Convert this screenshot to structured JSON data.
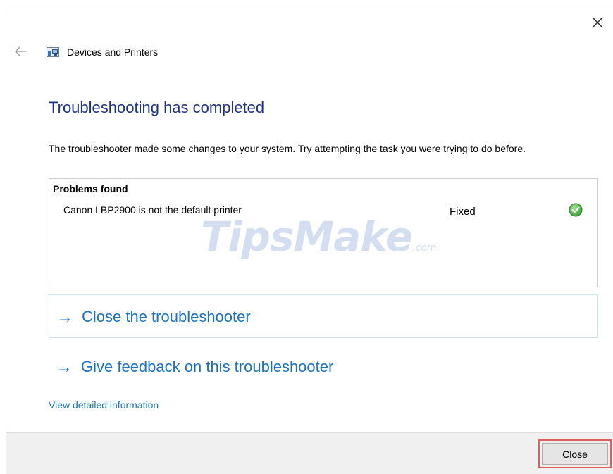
{
  "window": {
    "app_title": "Devices and Printers",
    "close_glyph": "✕"
  },
  "icons": {
    "back": "back-arrow-icon",
    "app": "devices-and-printers-icon",
    "check": "check-icon",
    "close": "close-icon"
  },
  "main": {
    "heading": "Troubleshooting has completed",
    "description": "The troubleshooter made some changes to your system. Try attempting the task you were trying to do before."
  },
  "problems": {
    "title": "Problems found",
    "items": [
      {
        "name": "Canon LBP2900 is not the default printer",
        "status": "Fixed"
      }
    ]
  },
  "watermark": {
    "main": "TipsMake",
    "suffix": ".com"
  },
  "links": {
    "arrow": "→",
    "close_troubleshooter": "Close the troubleshooter",
    "give_feedback": "Give feedback on this troubleshooter",
    "view_details": "View detailed information"
  },
  "footer": {
    "close_label": "Close"
  },
  "colors": {
    "heading": "#1e3287",
    "link": "#1a73c8",
    "highlight": "#e35d5d",
    "check": "#3aa53a"
  }
}
